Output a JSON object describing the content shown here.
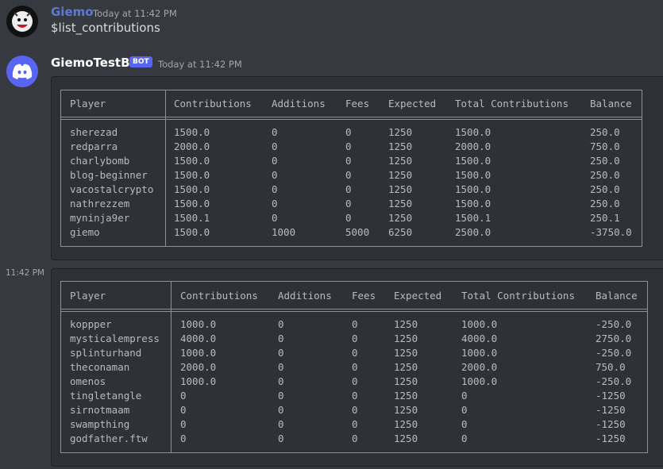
{
  "messages": [
    {
      "author": "Giemo",
      "timestamp": "Today at 11:42 PM",
      "content": "$list_contributions",
      "author_color": "#5b7bd5"
    },
    {
      "author": "GiemoTestBot",
      "badge": "BOT",
      "timestamp": "Today at 11:42 PM"
    }
  ],
  "side_timestamp": "11:42 PM",
  "colors": {
    "background": "#36393f",
    "embed": "#2f3136",
    "bot_badge": "#5865f2"
  },
  "icons": {
    "user_avatar": "clown-avatar-icon",
    "bot_avatar": "discord-logo-icon"
  },
  "tables": [
    {
      "headers": [
        "Player",
        "Contributions",
        "Additions",
        "Fees",
        "Expected",
        "Total Contributions",
        "Balance"
      ],
      "rows": [
        [
          "sherezad",
          "1500.0",
          "0",
          "0",
          "1250",
          "1500.0",
          "250.0"
        ],
        [
          "redparra",
          "2000.0",
          "0",
          "0",
          "1250",
          "2000.0",
          "750.0"
        ],
        [
          "charlybomb",
          "1500.0",
          "0",
          "0",
          "1250",
          "1500.0",
          "250.0"
        ],
        [
          "blog-beginner",
          "1500.0",
          "0",
          "0",
          "1250",
          "1500.0",
          "250.0"
        ],
        [
          "vacostalcrypto",
          "1500.0",
          "0",
          "0",
          "1250",
          "1500.0",
          "250.0"
        ],
        [
          "nathrezzem",
          "1500.0",
          "0",
          "0",
          "1250",
          "1500.0",
          "250.0"
        ],
        [
          "myninja9er",
          "1500.1",
          "0",
          "0",
          "1250",
          "1500.1",
          "250.1"
        ],
        [
          "giemo",
          "1500.0",
          "1000",
          "5000",
          "6250",
          "2500.0",
          "-3750.0"
        ]
      ]
    },
    {
      "headers": [
        "Player",
        "Contributions",
        "Additions",
        "Fees",
        "Expected",
        "Total Contributions",
        "Balance"
      ],
      "rows": [
        [
          "koppper",
          "1000.0",
          "0",
          "0",
          "1250",
          "1000.0",
          "-250.0"
        ],
        [
          "mysticalempress",
          "4000.0",
          "0",
          "0",
          "1250",
          "4000.0",
          "2750.0"
        ],
        [
          "splinturhand",
          "1000.0",
          "0",
          "0",
          "1250",
          "1000.0",
          "-250.0"
        ],
        [
          "theconaman",
          "2000.0",
          "0",
          "0",
          "1250",
          "2000.0",
          "750.0"
        ],
        [
          "omenos",
          "1000.0",
          "0",
          "0",
          "1250",
          "1000.0",
          "-250.0"
        ],
        [
          "tingletangle",
          "0",
          "0",
          "0",
          "1250",
          "0",
          "-1250"
        ],
        [
          "sirnotmaam",
          "0",
          "0",
          "0",
          "1250",
          "0",
          "-1250"
        ],
        [
          "swampthing",
          "0",
          "0",
          "0",
          "1250",
          "0",
          "-1250"
        ],
        [
          "godfather.ftw",
          "0",
          "0",
          "0",
          "1250",
          "0",
          "-1250"
        ]
      ]
    }
  ]
}
